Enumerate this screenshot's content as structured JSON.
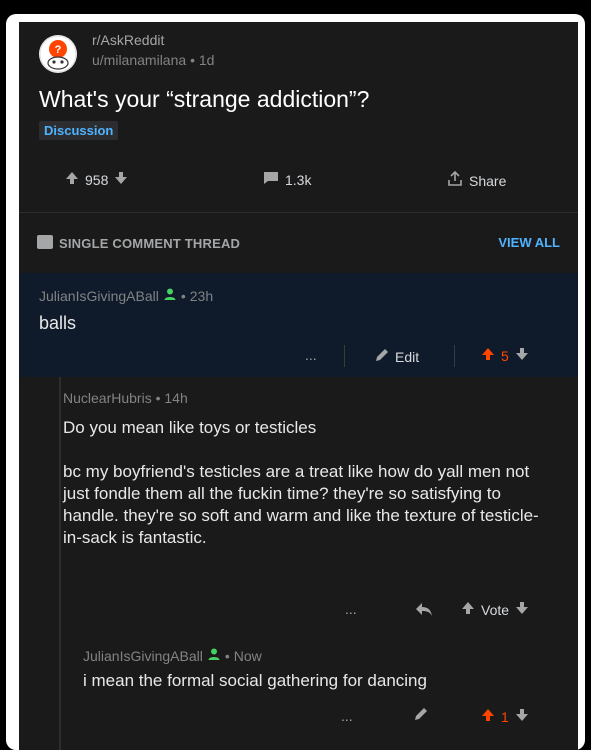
{
  "post": {
    "subreddit": "r/AskReddit",
    "user": "u/milanamilana",
    "age": "1d",
    "title": "What's your “strange addiction”?",
    "flair": "Discussion",
    "upvotes": "958",
    "comments": "1.3k",
    "share_label": "Share"
  },
  "thread_bar": {
    "label": "SINGLE COMMENT THREAD",
    "view_all": "VIEW ALL"
  },
  "comment1": {
    "author": "JulianIsGivingABall",
    "age": "23h",
    "body": "balls",
    "more": "...",
    "edit_label": "Edit",
    "score": "5"
  },
  "comment2": {
    "author": "NuclearHubris",
    "age": "14h",
    "body_p1": "Do you mean like toys or testicles",
    "body_p2": "bc my boyfriend's testicles are a treat like how do yall men not just fondle them all the fuckin time? they're so satisfying to handle. they're so soft and warm and like the texture of testicle-in-sack is fantastic.",
    "more": "...",
    "vote_label": "Vote"
  },
  "comment3": {
    "author": "JulianIsGivingABall",
    "age": "Now",
    "body": "i mean the formal social gathering for dancing",
    "more": "...",
    "score": "1"
  },
  "colors": {
    "background": "#1a1a1b",
    "highlight": "#0f1a2a",
    "accent_blue": "#4fb3ff",
    "upvote_orange": "#ff4500",
    "mod_green": "#46d160"
  },
  "icons": {
    "subreddit_avatar": "reddit-alien-question-icon",
    "upvote": "arrow-up-icon",
    "downvote": "arrow-down-icon",
    "comments": "comment-bubble-icon",
    "share": "share-icon",
    "thread": "chat-icon",
    "edit": "pencil-icon",
    "reply": "reply-arrow-icon",
    "user_badge": "person-icon"
  }
}
